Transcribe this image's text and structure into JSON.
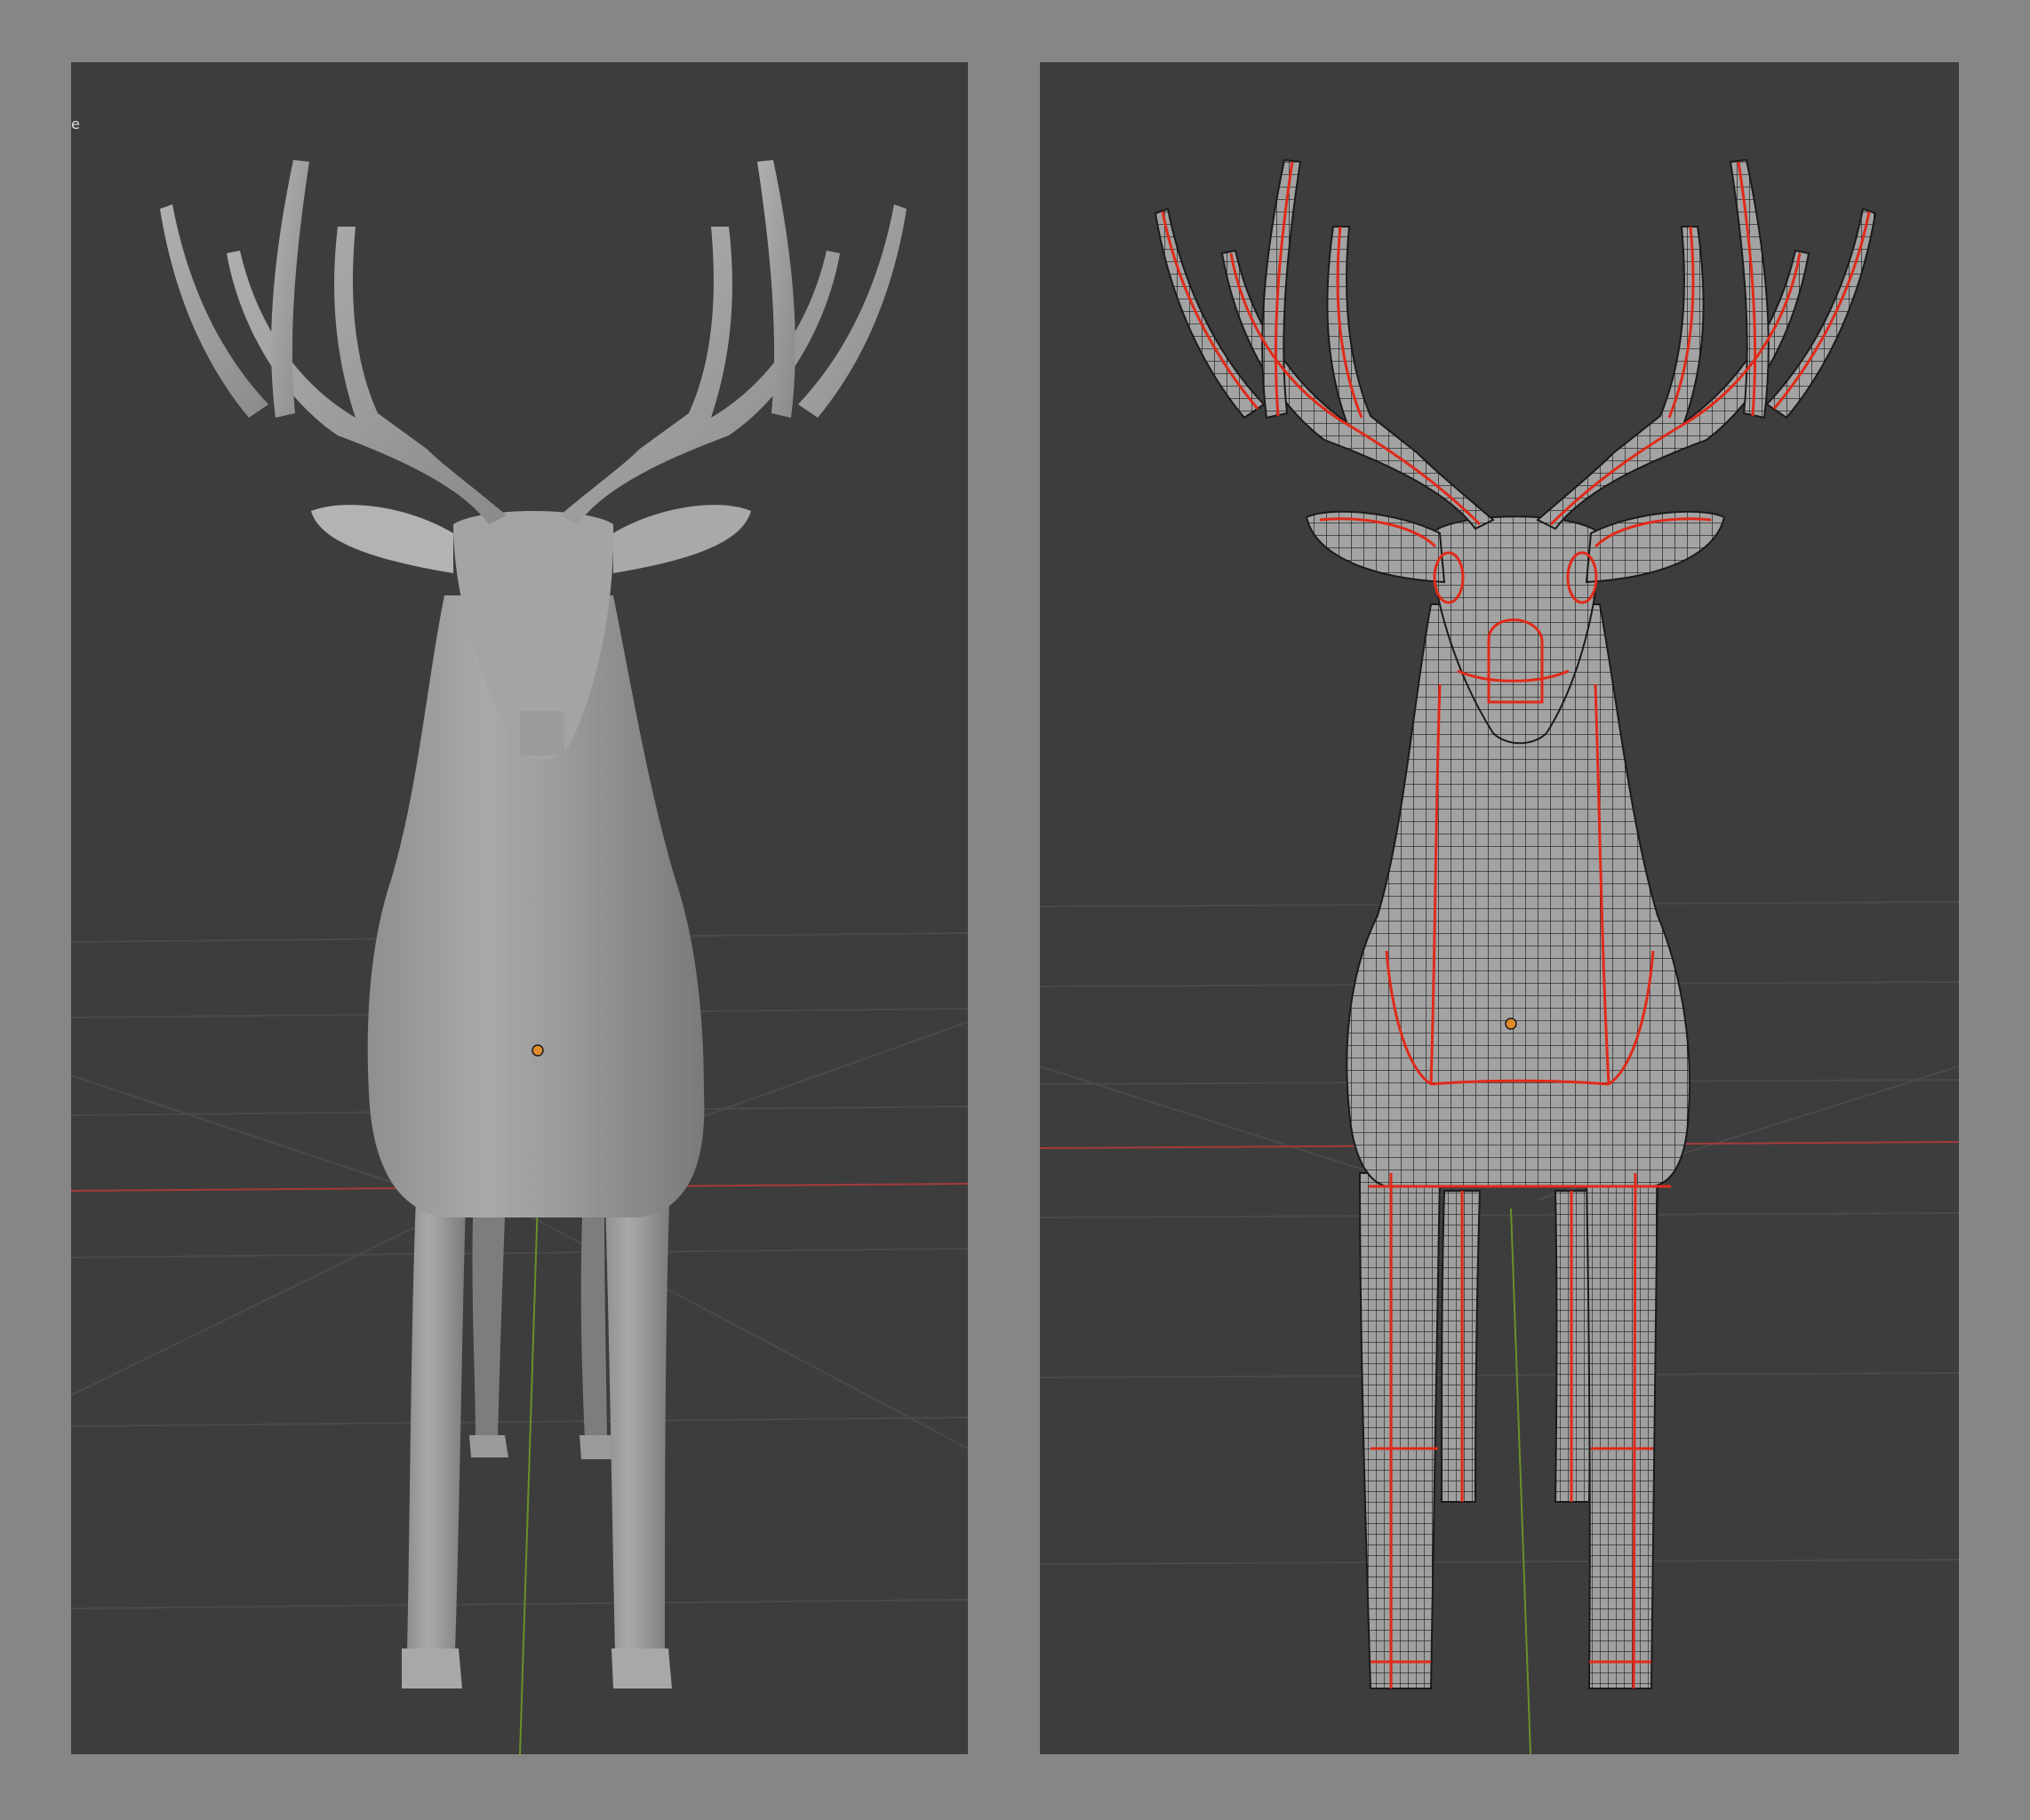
{
  "viewports": {
    "left": {
      "shading": "solid",
      "corner_text": "e"
    },
    "right": {
      "shading": "solid-wireframe",
      "seams": true
    }
  },
  "colors": {
    "frame_background": "#868686",
    "viewport_background": "#3d3d3d",
    "grid_line": "#4a4a4a",
    "x_axis": "#a53a3a",
    "y_axis": "#6b8f2a",
    "mesh_fill": "#a3a3a3",
    "wire": "#1a1a1a",
    "seam": "#e02a1a",
    "origin_point": "#e08a2a"
  },
  "icons": {
    "origin": "origin-dot-icon"
  }
}
